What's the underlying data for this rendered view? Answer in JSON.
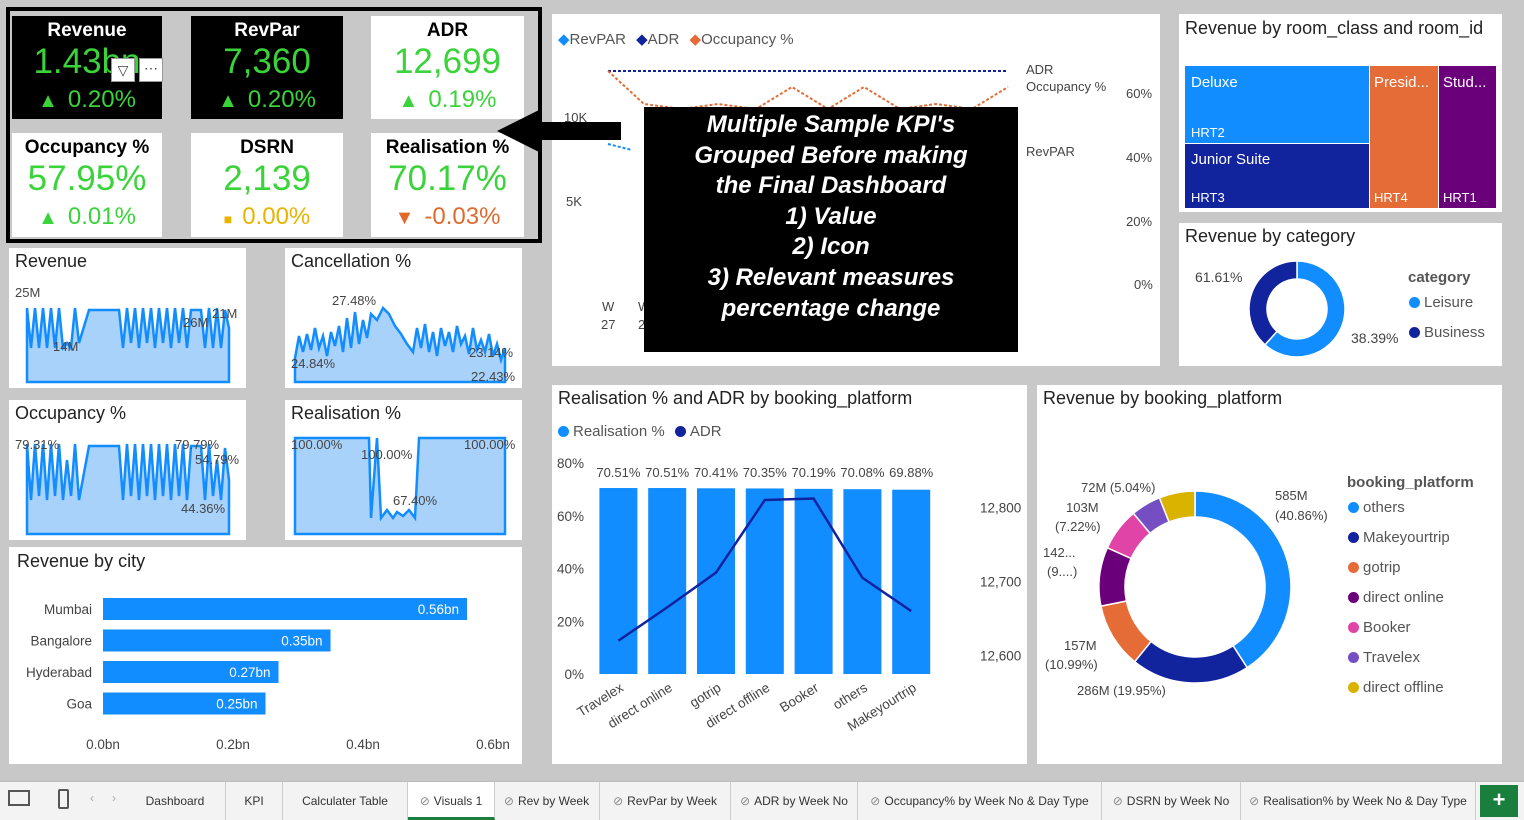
{
  "kpis": [
    {
      "title": "Revenue",
      "value": "1.43bn",
      "change": "0.20%",
      "icon": "up-triangle-icon"
    },
    {
      "title": "RevPar",
      "value": "7,360",
      "change": "0.20%",
      "icon": "up-triangle-icon"
    },
    {
      "title": "ADR",
      "value": "12,699",
      "change": "0.19%",
      "icon": "up-triangle-icon"
    },
    {
      "title": "Occupancy %",
      "value": "57.95%",
      "change": "0.01%",
      "icon": "up-triangle-icon"
    },
    {
      "title": "DSRN",
      "value": "2,139",
      "change": "0.00%",
      "icon": "square-icon"
    },
    {
      "title": "Realisation %",
      "value": "70.17%",
      "change": "-0.03%",
      "icon": "down-triangle-icon"
    }
  ],
  "colors": {
    "green": "#3ad33a",
    "amber": "#e8b400",
    "red": "#e06a2c",
    "blue": "#118dff",
    "navy": "#12239e",
    "orange": "#e66c37",
    "purple": "#6b007b",
    "pink": "#e044a7",
    "violet": "#744ec2",
    "gold": "#d9b300"
  },
  "annotation": {
    "lines": [
      "Multiple Sample KPI's",
      "Grouped Before making",
      "the Final Dashboard",
      "1) Value",
      "2) Icon",
      "3) Relevant measures",
      "percentage change"
    ]
  },
  "combo": {
    "legend": [
      "RevPAR",
      "ADR",
      "Occupancy %"
    ],
    "left_ticks": [
      "10K",
      "5K"
    ],
    "right_ticks": [
      "60%",
      "40%",
      "20%",
      "0%"
    ],
    "end_labels": [
      "ADR",
      "Occupancy %",
      "RevPAR"
    ],
    "x_ticks": [
      [
        "W",
        "27"
      ],
      [
        "W",
        "2"
      ]
    ]
  },
  "small_visuals": {
    "revenue": {
      "title": "Revenue",
      "labels": [
        "25M",
        "21M",
        "26M",
        "14M"
      ]
    },
    "cancellation": {
      "title": "Cancellation %",
      "labels": [
        "27.48%",
        "24.84%",
        "23.14%",
        "22.43%"
      ]
    },
    "occupancy": {
      "title": "Occupancy %",
      "labels": [
        "79.31%",
        "79.79%",
        "54.79%",
        "44.36%"
      ]
    },
    "realisation": {
      "title": "Realisation %",
      "labels": [
        "100.00%",
        "100.00%",
        "100.00%",
        "67.40%"
      ]
    }
  },
  "treemap": {
    "title": "Revenue by room_class and room_id",
    "cells": [
      {
        "label": "Deluxe",
        "id": "HRT2"
      },
      {
        "label": "Junior Suite",
        "id": "HRT3"
      },
      {
        "label": "Presid...",
        "id": "HRT4"
      },
      {
        "label": "Stud...",
        "id": "HRT1"
      }
    ]
  },
  "category": {
    "title": "Revenue by category",
    "legend_title": "category",
    "items": [
      {
        "name": "Leisure",
        "label": "61.61%"
      },
      {
        "name": "Business",
        "label": "38.39%"
      }
    ]
  },
  "city": {
    "title": "Revenue by city",
    "x_ticks": [
      "0.0bn",
      "0.2bn",
      "0.4bn",
      "0.6bn"
    ]
  },
  "platform_combo": {
    "title": "Realisation % and ADR by booking_platform",
    "legend": [
      "Realisation %",
      "ADR"
    ],
    "left_ticks": [
      "80%",
      "60%",
      "40%",
      "20%",
      "0%"
    ],
    "right_ticks": [
      "12,800",
      "12,700",
      "12,600"
    ]
  },
  "platform_donut": {
    "title": "Revenue by booking_platform",
    "legend_title": "booking_platform",
    "labels": [
      "585M",
      "(40.86%)",
      "286M (19.95%)",
      "157M",
      "(10.99%)",
      "142...",
      "(9....)",
      "103M",
      "(7.22%)",
      "72M (5.04%)"
    ]
  },
  "chart_data": [
    {
      "type": "bar",
      "title": "Revenue by city",
      "orientation": "horizontal",
      "categories": [
        "Mumbai",
        "Bangalore",
        "Hyderabad",
        "Goa"
      ],
      "values": [
        0.56,
        0.35,
        0.27,
        0.25
      ],
      "data_labels": [
        "0.56bn",
        "0.35bn",
        "0.27bn",
        "0.25bn"
      ],
      "xlim": [
        0,
        0.6
      ]
    },
    {
      "type": "bar",
      "title": "Realisation % and ADR by booking_platform",
      "categories": [
        "Travelex",
        "direct online",
        "gotrip",
        "direct offline",
        "Booker",
        "others",
        "Makeyourtrip"
      ],
      "series": [
        {
          "name": "Realisation %",
          "values": [
            70.51,
            70.51,
            70.41,
            70.35,
            70.19,
            70.08,
            69.88
          ],
          "data_labels": [
            "70.51%",
            "70.51%",
            "70.41%",
            "70.35%",
            "70.19%",
            "70.08%",
            "69.88%"
          ]
        },
        {
          "name": "ADR",
          "type": "line",
          "values": [
            12620,
            12665,
            12712,
            12810,
            12812,
            12705,
            12660
          ]
        }
      ],
      "ylim": [
        0,
        80
      ],
      "y2lim": [
        12575,
        12860
      ]
    },
    {
      "type": "pie",
      "title": "Revenue by booking_platform",
      "categories": [
        "others",
        "Makeyourtrip",
        "gotrip",
        "direct online",
        "Booker",
        "Travelex",
        "direct offline"
      ],
      "values": [
        40.86,
        19.95,
        10.99,
        9.9,
        7.22,
        5.04,
        6.04
      ]
    },
    {
      "type": "pie",
      "title": "Revenue by category",
      "categories": [
        "Leisure",
        "Business"
      ],
      "values": [
        61.61,
        38.39
      ]
    }
  ],
  "tabs": [
    "Dashboard",
    "KPI",
    "Calculater Table",
    "Visuals 1",
    "Rev by Week",
    "RevPar by Week",
    "ADR by Week No",
    "Occupancy% by Week No & Day Type",
    "DSRN by Week No",
    "Realisation% by Week No & Day Type"
  ]
}
